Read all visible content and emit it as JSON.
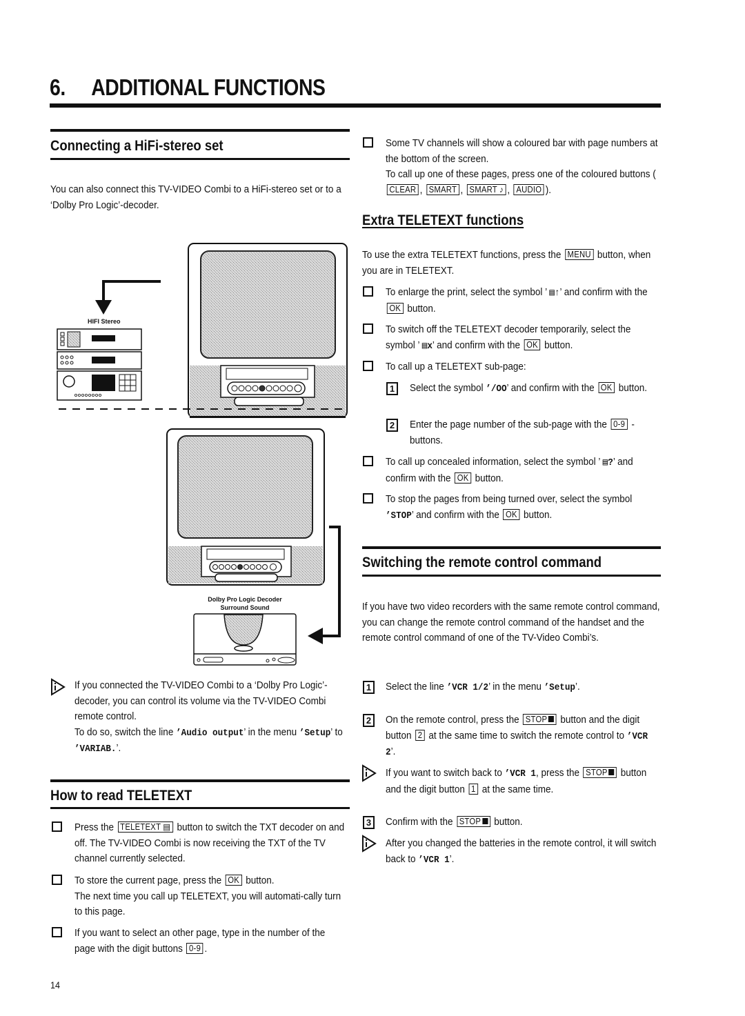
{
  "chapter": {
    "number": "6.",
    "title": "ADDITIONAL FUNCTIONS"
  },
  "sections": {
    "hifi": {
      "title": "Connecting a HiFi-stereo set",
      "intro": "You can also connect this TV-VIDEO Combi to a HiFi-stereo set or to a ‘Dolby Pro Logic’-decoder.",
      "diagram": {
        "hifi_label": "HIFI Stereo",
        "dolby_label_1": "Dolby Pro Logic Decoder",
        "dolby_label_2": "Surround Sound"
      },
      "info": {
        "line1": "If you connected the TV-VIDEO Combi to a ‘Dolby Pro Logic’-decoder, you can control its volume via the TV-VIDEO Combi remote control.",
        "line2_pre": "To do so, switch the line ",
        "line2_code1": "’Audio output",
        "line2_mid": "’ in the menu ",
        "line2_code2": "’Setup",
        "line2_mid2": "’ to ",
        "line2_code3": "’VARIAB.",
        "line2_end": "’."
      }
    },
    "teletext": {
      "title": "How to read TELETEXT",
      "items": [
        {
          "pre": "Press the ",
          "key": "TELETEXT ▤",
          "post": " button to switch the TXT decoder on and off. The TV-VIDEO Combi is now receiving the TXT of the TV channel currently selected."
        },
        {
          "pre": "To store the current page, press the ",
          "key": "OK",
          "post": " button.",
          "extra": "The next time you call up TELETEXT, you will automati-cally turn to this page."
        },
        {
          "pre": "If you want to select an other page, type in the number of the page with the digit buttons ",
          "key": "0-9",
          "post": "."
        }
      ]
    },
    "coloured": {
      "line1": "Some TV channels will show a coloured bar with page numbers at the bottom of the screen.",
      "line2": "To call up one of these pages, press one of the coloured buttons (",
      "keys": [
        "CLEAR",
        "SMART",
        "SMART ♪",
        "AUDIO"
      ],
      "end": ")."
    },
    "extra": {
      "title": "Extra TELETEXT functions",
      "intro_pre": "To use the extra TELETEXT functions, press the ",
      "intro_key": "MENU",
      "intro_post": " button, when you are in TELETEXT.",
      "items": [
        {
          "pre": "To enlarge the print, select the symbol ’ ",
          "sym": "▤↑",
          "mid": "’ and confirm with the ",
          "key": "OK",
          "post": " button."
        },
        {
          "pre": "To switch off the TELETEXT decoder temporarily, select the symbol ’ ",
          "sym": "▤x",
          "mid": "’ and confirm with the ",
          "key": "OK",
          "post": " button."
        },
        {
          "pre": "To call up a TELETEXT sub-page:"
        },
        {
          "pre": "To call up concealed information, select the symbol ’ ",
          "sym": "▤?",
          "mid": "’ and confirm with the ",
          "key": "OK",
          "post": " button."
        },
        {
          "pre": "To stop the pages from being turned over, select the symbol ",
          "sym": "’STOP",
          "mid": "’ and confirm with the ",
          "key": "OK",
          "post": " button."
        }
      ],
      "sub_steps": [
        {
          "num": "1",
          "pre": "Select the symbol ",
          "sym": "’/OO",
          "mid": "’ and confirm with the ",
          "key": "OK",
          "post": " button."
        },
        {
          "num": "2",
          "pre": "Enter the page number of the sub-page with the ",
          "key": "0-9",
          "post": " -buttons."
        }
      ]
    },
    "remote": {
      "title": "Switching the remote control command",
      "intro": "If you have two video recorders with the same remote control command, you can change the remote control command of the handset and the remote control command of one of the TV-Video Combi’s.",
      "steps": [
        {
          "num": "1",
          "pre": "Select the line ",
          "code1": "’VCR 1/2",
          "mid": "’ in the menu ",
          "code2": "’Setup",
          "post": "’."
        },
        {
          "num": "2",
          "pre": "On the remote control, press the ",
          "key": "STOP",
          "mid": " button and the digit button ",
          "key2": "2",
          "post": " at the same time to switch the remote control to ",
          "code": "’VCR 2",
          "end": "’."
        },
        {
          "num": "3",
          "pre": "Confirm with the ",
          "key": "STOP",
          "post": " button."
        }
      ],
      "info1": {
        "pre": "If you want to switch back to ",
        "code": "’VCR 1",
        "mid": ", press the ",
        "key": "STOP",
        "mid2": " button and the digit button ",
        "key2": "1",
        "post": " at the same time."
      },
      "info2": {
        "pre": "After you changed the batteries in the remote control, it will switch back to ",
        "code": "’VCR 1",
        "post": "’."
      }
    }
  },
  "page_number": "14"
}
